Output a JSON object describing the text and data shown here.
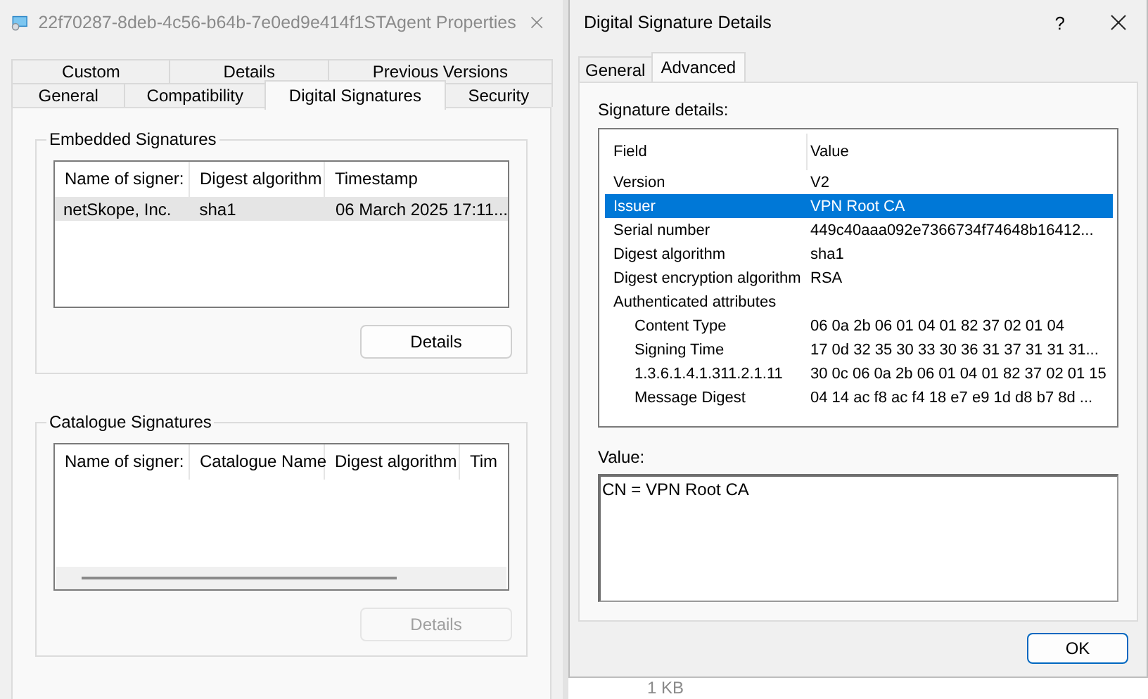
{
  "properties_window": {
    "title": "22f70287-8deb-4c56-b64b-7e0ed9e414f1STAgent Properties",
    "tab_rows": [
      [
        {
          "label": "Custom",
          "selected": false
        },
        {
          "label": "Details",
          "selected": false
        },
        {
          "label": "Previous Versions",
          "selected": false
        }
      ],
      [
        {
          "label": "General",
          "selected": false
        },
        {
          "label": "Compatibility",
          "selected": false
        },
        {
          "label": "Digital Signatures",
          "selected": true
        },
        {
          "label": "Security",
          "selected": false
        }
      ]
    ],
    "embedded_signatures": {
      "title": "Embedded Signatures",
      "columns": [
        "Name of signer:",
        "Digest algorithm",
        "Timestamp"
      ],
      "rows": [
        {
          "cells": [
            "netSkope, Inc.",
            "sha1",
            "06 March 2025 17:11..."
          ],
          "selected": true
        }
      ],
      "button": {
        "label": "Details",
        "disabled": false
      }
    },
    "catalogue_signatures": {
      "title": "Catalogue Signatures",
      "columns": [
        "Name of signer:",
        "Catalogue Name",
        "Digest algorithm",
        "Tim"
      ],
      "button": {
        "label": "Details",
        "disabled": true
      }
    }
  },
  "details_dialog": {
    "title": "Digital Signature Details",
    "help": "?",
    "tabs": [
      {
        "label": "General",
        "selected": false
      },
      {
        "label": "Advanced",
        "selected": true
      }
    ],
    "list_label": "Signature details:",
    "columns": [
      "Field",
      "Value"
    ],
    "rows": [
      {
        "field": "Version",
        "value": "V2",
        "selected": false
      },
      {
        "field": "Issuer",
        "value": "VPN Root CA",
        "selected": true
      },
      {
        "field": "Serial number",
        "value": "449c40aaa092e7366734f74648b16412...",
        "selected": false
      },
      {
        "field": "Digest algorithm",
        "value": "sha1",
        "selected": false
      },
      {
        "field": "Digest encryption algorithm",
        "value": "RSA",
        "selected": false
      },
      {
        "field": "Authenticated attributes",
        "selected": false,
        "children": [
          {
            "field": "Content Type",
            "value": "06 0a 2b 06 01 04 01 82 37 02 01 04",
            "selected": false
          },
          {
            "field": "Signing Time",
            "value": "17 0d 32 35 30 33 30 36 31 37 31 31 31...",
            "selected": false
          },
          {
            "field": "1.3.6.1.4.1.311.2.1.11",
            "value": "30 0c 06 0a 2b 06 01 04 01 82 37 02 01 15",
            "selected": false
          },
          {
            "field": "Message Digest",
            "value": "04 14 ac f8 ac f4 18 e7 e9 1d d8 b7 8d ...",
            "selected": false
          }
        ]
      }
    ],
    "value_label": "Value:",
    "value_text": "CN = VPN Root CA",
    "ok_button": "OK"
  },
  "background_text": "1 KB"
}
